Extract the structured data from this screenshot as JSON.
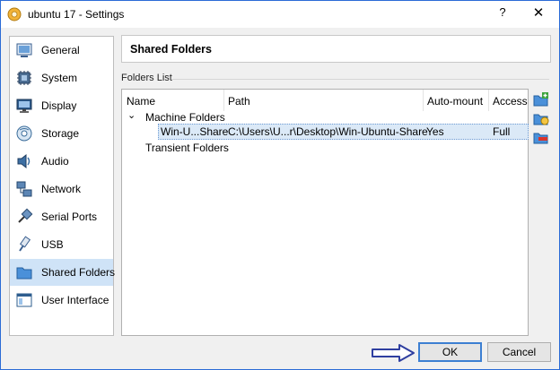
{
  "window": {
    "title": "ubuntu 17 - Settings",
    "help": "?",
    "close": "✕"
  },
  "sidebar": {
    "items": [
      {
        "label": "General",
        "icon": "general-icon"
      },
      {
        "label": "System",
        "icon": "system-chip-icon"
      },
      {
        "label": "Display",
        "icon": "display-monitor-icon"
      },
      {
        "label": "Storage",
        "icon": "storage-disk-icon"
      },
      {
        "label": "Audio",
        "icon": "audio-speaker-icon"
      },
      {
        "label": "Network",
        "icon": "network-icon"
      },
      {
        "label": "Serial Ports",
        "icon": "serial-plug-icon"
      },
      {
        "label": "USB",
        "icon": "usb-icon"
      },
      {
        "label": "Shared Folders",
        "icon": "folder-icon",
        "selected": true
      },
      {
        "label": "User Interface",
        "icon": "user-interface-icon"
      }
    ]
  },
  "page": {
    "title": "Shared Folders"
  },
  "folders_list": {
    "group_label": "Folders List",
    "columns": [
      "Name",
      "Path",
      "Auto-mount",
      "Access"
    ],
    "machine_folders_label": "Machine Folders",
    "expander": "⌄",
    "rows": [
      {
        "name": "Win-U...Share",
        "path": "C:\\Users\\U...r\\Desktop\\Win-Ubuntu-Share",
        "automount": "Yes",
        "access": "Full"
      }
    ],
    "transient_folders_label": "Transient Folders"
  },
  "tools": [
    "add-folder-icon",
    "edit-folder-icon",
    "remove-folder-icon"
  ],
  "buttons": {
    "ok": "OK",
    "cancel": "Cancel"
  },
  "colors": {
    "selection": "#cfe3f7",
    "accent": "#3c7fd2",
    "window_border": "#2b6bd6"
  }
}
